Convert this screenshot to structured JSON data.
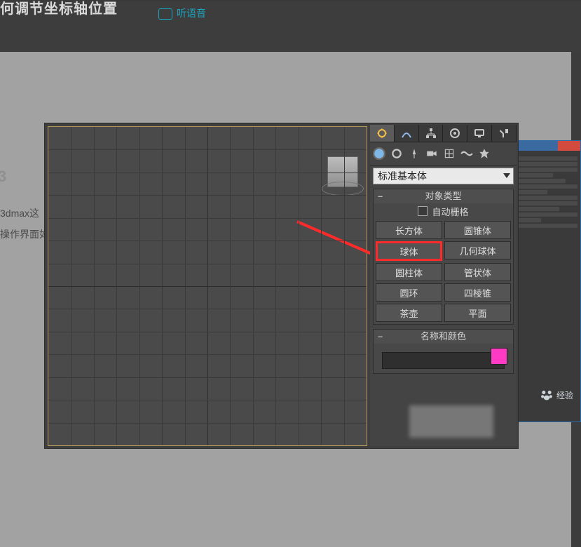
{
  "header": {
    "title_fragment": "何调节坐标轴位置",
    "audio_label": "听语音"
  },
  "side": {
    "line1": "3dmax这",
    "line2": "操作界面如"
  },
  "panel": {
    "dropdown_selected": "标准基本体",
    "rollout_objtype": "对象类型",
    "autogrid_label": "自动栅格",
    "buttons": {
      "box": "长方体",
      "cone": "圆锥体",
      "sphere": "球体",
      "geosphere": "几何球体",
      "cylinder": "圆柱体",
      "tube": "管状体",
      "torus": "圆环",
      "pyramid": "四棱锥",
      "teapot": "茶壶",
      "plane": "平面"
    },
    "rollout_namecolor": "名称和颜色"
  },
  "badge": {
    "text": "经验"
  }
}
